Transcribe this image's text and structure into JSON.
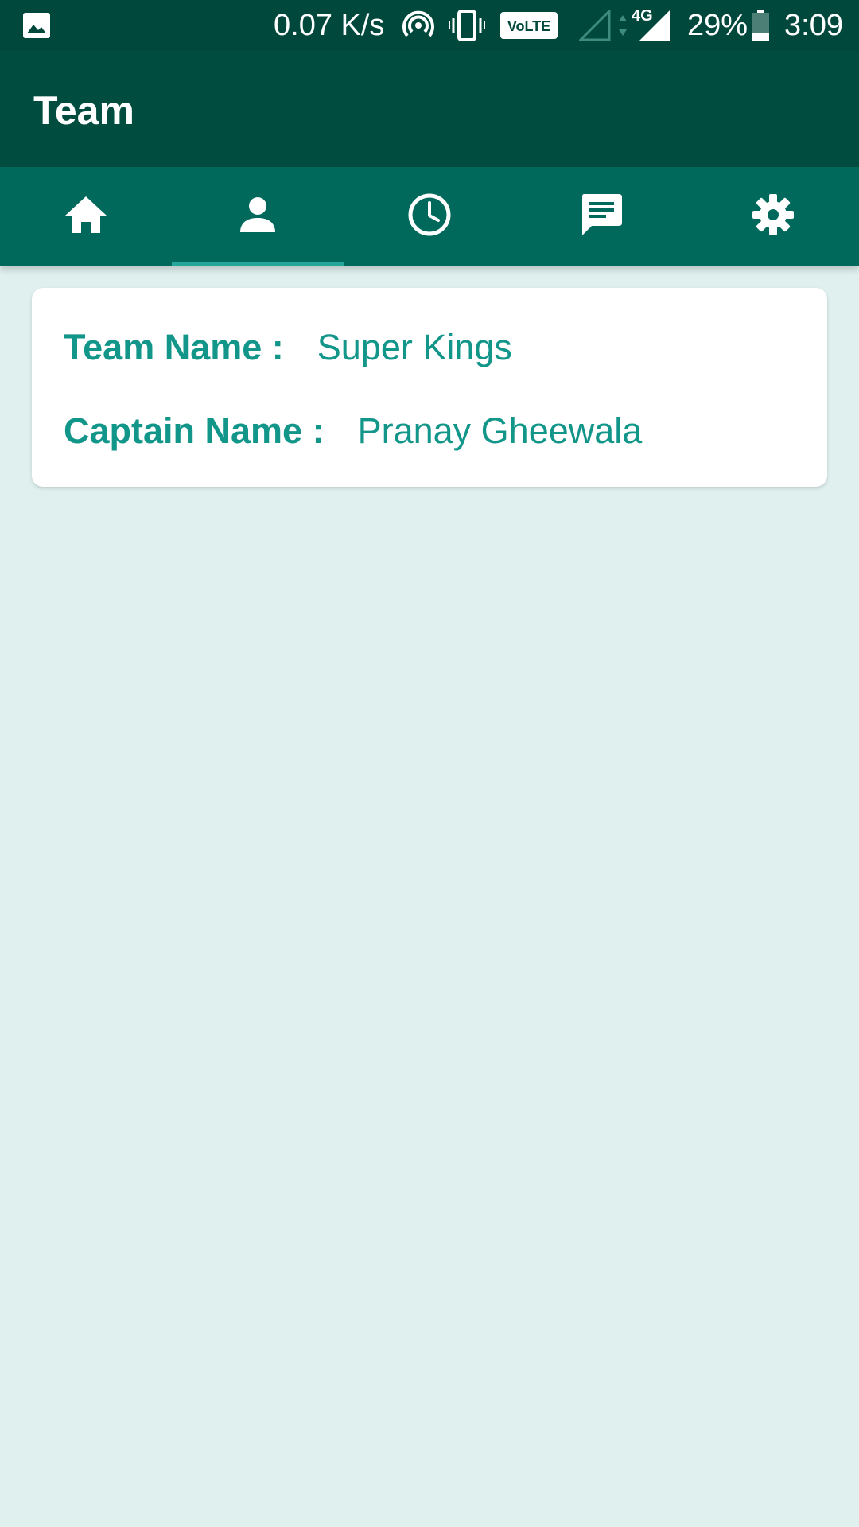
{
  "status_bar": {
    "network_speed": "0.07 K/s",
    "volte_label": "VoLTE",
    "network_type": "4G",
    "battery_percent": "29%",
    "battery_level": 0.29,
    "time": "3:09",
    "icons": [
      "image-notification-icon",
      "hotspot-icon",
      "vibrate-icon",
      "volte-icon",
      "signal-empty-icon",
      "data-arrows-icon",
      "signal-full-icon",
      "battery-icon"
    ]
  },
  "app_bar": {
    "title": "Team"
  },
  "tabs": [
    {
      "icon": "home-icon",
      "selected": false
    },
    {
      "icon": "person-icon",
      "selected": true
    },
    {
      "icon": "clock-icon",
      "selected": false
    },
    {
      "icon": "message-icon",
      "selected": false
    },
    {
      "icon": "settings-gear-icon",
      "selected": false
    }
  ],
  "team_card": {
    "team_name_label": "Team Name :",
    "team_name_value": "Super Kings",
    "captain_name_label": "Captain Name :",
    "captain_name_value": "Pranay Gheewala"
  },
  "colors": {
    "status_bar": "#00483c",
    "app_bar": "#004d40",
    "tab_bar": "#00695c",
    "tab_indicator": "#26a69a",
    "accent_text": "#13968a",
    "background": "#dff0ef"
  }
}
